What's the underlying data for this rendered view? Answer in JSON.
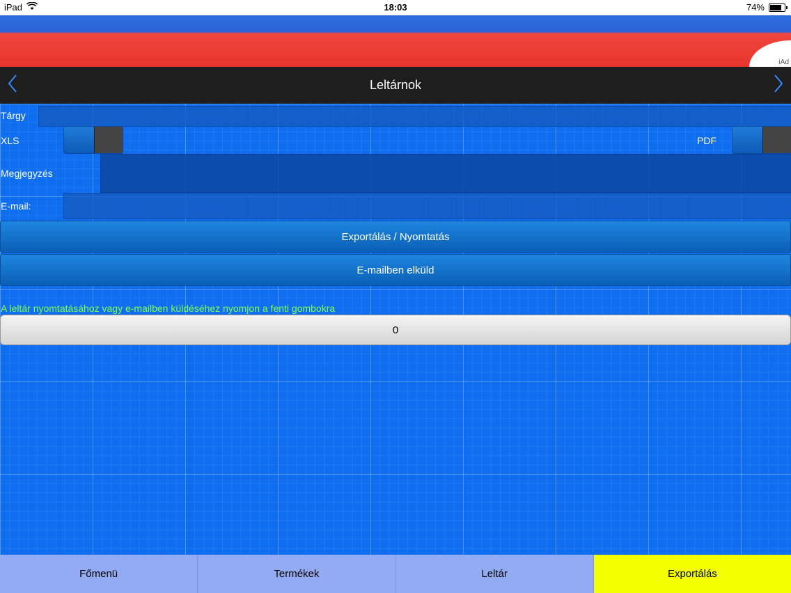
{
  "status_bar": {
    "device": "iPad",
    "time": "18:03",
    "battery": "74%",
    "battery_level": 0.74
  },
  "ad": {
    "label": "iAd"
  },
  "nav": {
    "title": "Leltárnok",
    "back_icon": "chevron-left-icon",
    "forward_icon": "chevron-right-icon"
  },
  "form": {
    "subject_label": "Tárgy",
    "subject_value": "",
    "xls_label": "XLS",
    "xls_on": true,
    "pdf_label": "PDF",
    "pdf_on": true,
    "note_label": "Megjegyzés",
    "note_value": "",
    "email_label": "E-mail:",
    "email_value": ""
  },
  "actions": {
    "export_print": "Exportálás / Nyomtatás",
    "send_email": "E-mailben elküld"
  },
  "hint": "A leltár nyomtatásához vagy e-mailben küldéséhez nyomjon a fenti gombokra",
  "counter": "0",
  "tabs": [
    {
      "label": "Főmenü",
      "active": false
    },
    {
      "label": "Termékek",
      "active": false
    },
    {
      "label": "Leltár",
      "active": false
    },
    {
      "label": "Exportálás",
      "active": true
    }
  ],
  "colors": {
    "background": "#0f6ef0",
    "hint": "#7dff4a",
    "tab": "#93abf2",
    "tab_active": "#f4ff00"
  }
}
